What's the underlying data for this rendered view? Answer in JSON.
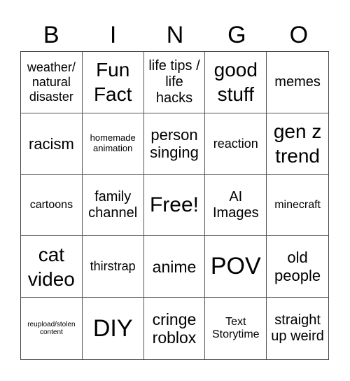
{
  "header": [
    "B",
    "I",
    "N",
    "G",
    "O"
  ],
  "cells": [
    "weather/ natural disaster",
    "Fun Fact",
    "life tips / life hacks",
    "good stuff",
    "memes",
    "racism",
    "homemade animation",
    "person singing",
    "reaction",
    "gen z trend",
    "cartoons",
    "family channel",
    "Free!",
    "AI Images",
    "minecraft",
    "cat video",
    "thirstrap",
    "anime",
    "POV",
    "old people",
    "reupload/stolen content",
    "DIY",
    "cringe roblox",
    "Text Storytime",
    "straight up weird"
  ]
}
